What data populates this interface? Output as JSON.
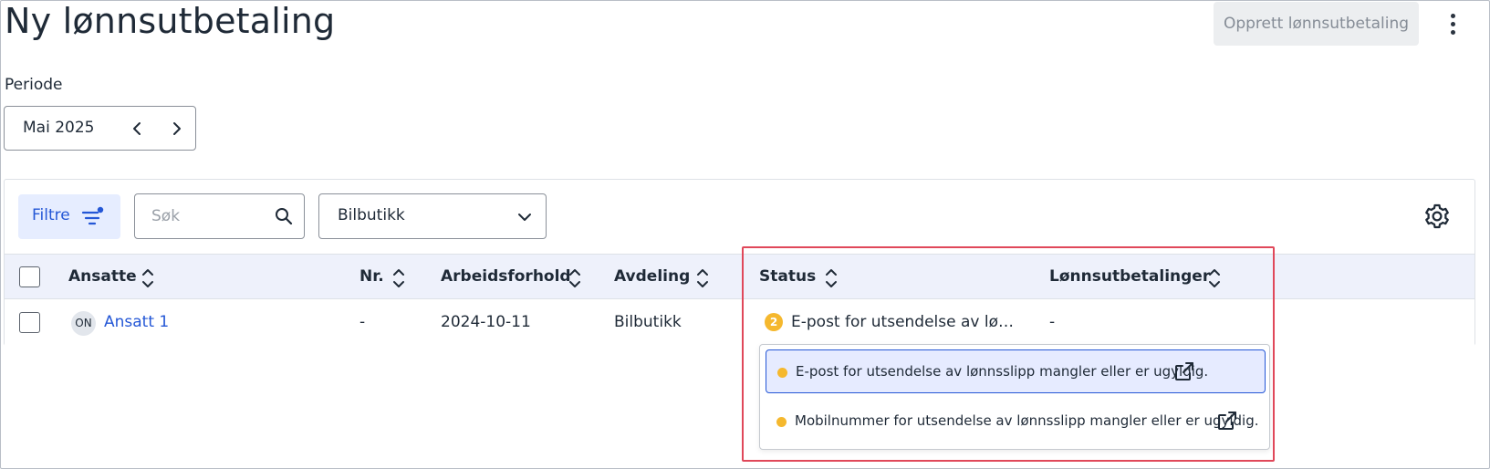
{
  "header": {
    "title": "Ny lønnsutbetaling",
    "create_button": "Opprett lønnsutbetaling"
  },
  "periode": {
    "label": "Periode",
    "value": "Mai 2025"
  },
  "toolbar": {
    "filter_label": "Filtre",
    "search_placeholder": "Søk",
    "department_value": "Bilbutikk"
  },
  "table": {
    "columns": [
      "Ansatte",
      "Nr.",
      "Arbeidsforhold",
      "Avdeling",
      "Status",
      "Lønnsutbetalinger"
    ],
    "rows": [
      {
        "initials": "ON",
        "name": "Ansatt 1",
        "nr": "-",
        "arbeidsforhold": "2024-10-11",
        "avdeling": "Bilbutikk",
        "status_count": "2",
        "status": "E-post for utsendelse av lønn…",
        "lonnsutbetalinger": "-"
      }
    ]
  },
  "status_popover": {
    "items": [
      "E-post for utsendelse av lønnsslipp mangler eller er ugyldig.",
      "Mobilnummer for utsendelse av lønnsslipp mangler eller er ugyldig."
    ]
  },
  "colors": {
    "accent": "#2457d6",
    "warning": "#f5b82e",
    "highlight": "#e0485a",
    "header_bg": "#eef1fb"
  }
}
